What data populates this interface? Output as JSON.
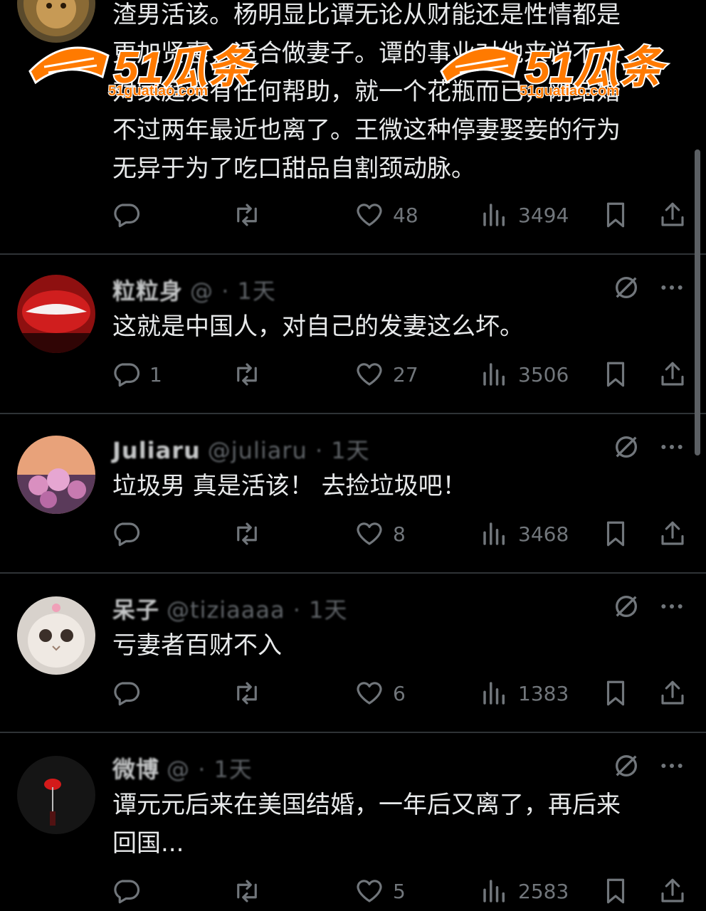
{
  "posts": [
    {
      "name": "",
      "handle": "",
      "text": "渣男活该。杨明显比谭无论从财能还是性情都是\n更加贤惠，适合做妻子。谭的事业对他来说不太\n对家庭没有任何帮助，就一个花瓶而已，刚结婚\n不过两年最近也离了。王微这种停妻娶妾的行为\n无异于为了吃口甜品自割颈动脉。",
      "replies": "",
      "likes": "48",
      "views": "3494"
    },
    {
      "name": "粒粒身",
      "handle": "@ · 1天",
      "text": "这就是中国人，对自己的发妻这么坏。",
      "replies": "1",
      "likes": "27",
      "views": "3506"
    },
    {
      "name": "Juliaru",
      "handle": "@juliaru · 1天",
      "text": "垃圾男 真是活该！ 去捡垃圾吧！",
      "replies": "",
      "likes": "8",
      "views": "3468"
    },
    {
      "name": "呆子",
      "handle": "@tiziaaaa · 1天",
      "text": "亏妻者百财不入",
      "replies": "",
      "likes": "6",
      "views": "1383"
    },
    {
      "name": "微博",
      "handle": "@ · 1天",
      "text": "谭元元后来在美国结婚，一年后又离了，再后来\n回国...",
      "replies": "",
      "likes": "5",
      "views": "2583"
    }
  ],
  "watermark": {
    "brand": "51瓜条",
    "url": "51guatiao.com"
  },
  "icons": {
    "reply": "reply-icon",
    "retweet": "retweet-icon",
    "like": "heart-icon",
    "views": "views-icon",
    "bookmark": "bookmark-icon",
    "share": "share-icon",
    "grok": "grok-icon",
    "more": "more-icon"
  },
  "colors": {
    "background": "#000000",
    "text": "#e7e9ea",
    "muted": "#71767b",
    "divider": "#2f3336",
    "watermark": "#ff7a00"
  }
}
